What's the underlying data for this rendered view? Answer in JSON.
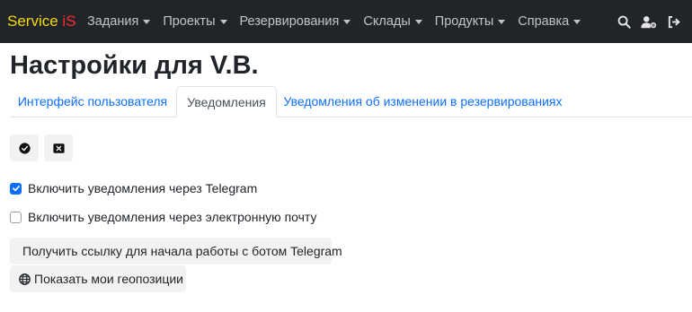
{
  "navbar": {
    "brand_part1": "Service ",
    "brand_part2": "iS",
    "menu": [
      {
        "label": "Задания"
      },
      {
        "label": "Проекты"
      },
      {
        "label": "Резервирования"
      },
      {
        "label": "Склады"
      },
      {
        "label": "Продукты"
      },
      {
        "label": "Справка"
      }
    ],
    "icons": [
      "search-icon",
      "user-settings-icon",
      "logout-icon"
    ]
  },
  "page": {
    "title": "Настройки для V.B."
  },
  "tabs": [
    {
      "label": "Интерфейс пользователя",
      "active": false
    },
    {
      "label": "Уведомления",
      "active": true
    },
    {
      "label": "Уведомления об изменении в резервированиях",
      "active": false
    }
  ],
  "toolbar": {
    "icons": [
      "check-circle-icon",
      "close-square-icon"
    ]
  },
  "settings": {
    "telegram_label": "Включить уведомления через Telegram",
    "telegram_checked": true,
    "email_label": "Включить уведомления через электронную почту",
    "email_checked": false
  },
  "actions": {
    "telegram_link_label": "Получить ссылку для начала работы с ботом Telegram",
    "geo_label": "Показать мои геопозиции"
  },
  "colors": {
    "navbar_bg": "#212529",
    "brand_yellow": "#f5d90a",
    "brand_red": "#ff2a2a",
    "link_blue": "#0d6efd",
    "button_bg": "#f2f2f2"
  }
}
